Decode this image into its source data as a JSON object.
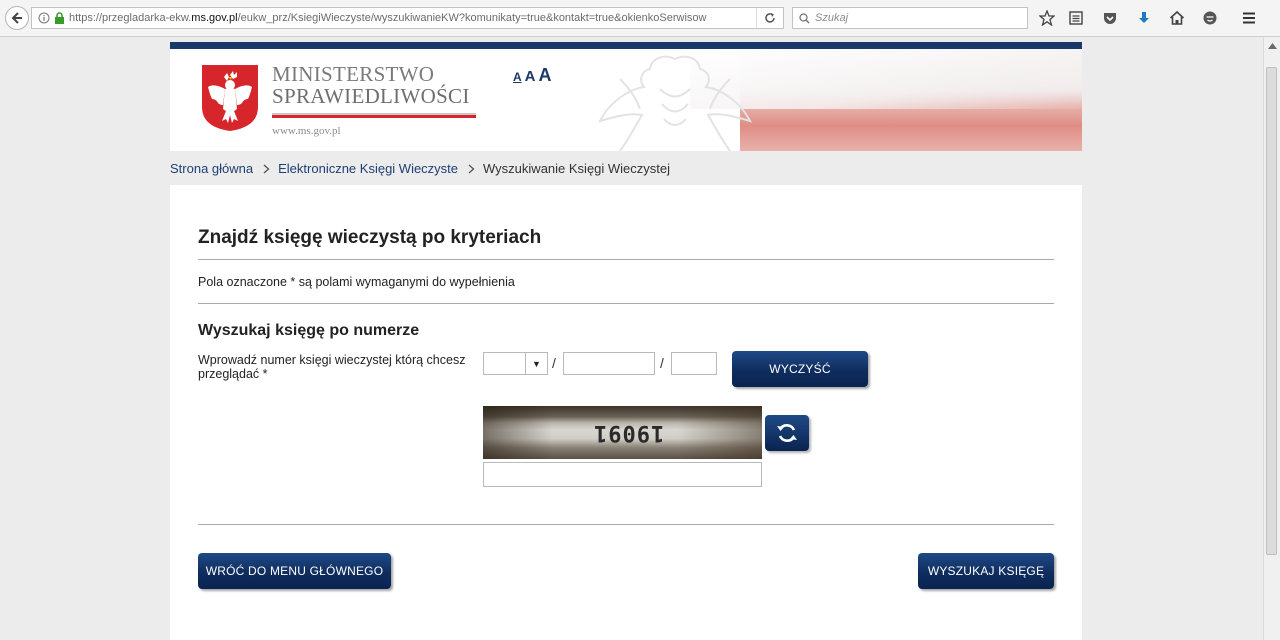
{
  "browser": {
    "url_prefix": "https://przegladarka-ekw.",
    "url_domain": "ms.gov.pl",
    "url_path": "/eukw_prz/KsiegiWieczyste/wyszukiwanieKW?komunikaty=true&kontakt=true&okienkoSerwisow",
    "search_placeholder": "Szukaj",
    "icons": [
      "back-icon",
      "info-icon",
      "lock-icon",
      "reload-icon",
      "search-icon",
      "star-icon",
      "reader-icon",
      "pocket-icon",
      "download-icon",
      "home-icon",
      "sync-icon",
      "menu-icon"
    ]
  },
  "header": {
    "ministry_line1": "MINISTERSTWO",
    "ministry_line2": "SPRAWIEDLIWOŚCI",
    "ministry_url": "www.ms.gov.pl",
    "font_size_small": "A",
    "font_size_medium": "A",
    "font_size_large": "A"
  },
  "breadcrumb": {
    "home": "Strona główna",
    "section": "Elektroniczne Księgi Wieczyste",
    "current": "Wyszukiwanie Księgi Wieczystej"
  },
  "form": {
    "title": "Znajdź księgę wieczystą po kryteriach",
    "required_note": "Pola oznaczone * są polami wymaganymi do wypełnienia",
    "subtitle": "Wyszukaj księgę po numerze",
    "number_label": "Wprowadź numer księgi wieczystej którą chcesz przeglądać *",
    "court_code_value": "",
    "kw_number_value": "",
    "check_digit_value": "",
    "separator": "/",
    "clear_button": "WYCZYŚĆ",
    "captcha_text": "19091",
    "captcha_input_value": "",
    "back_button": "WRÓĆ DO MENU GŁÓWNEGO",
    "search_button": "WYSZUKAJ KSIĘGĘ"
  },
  "colors": {
    "brand_navy": "#1b3968",
    "link": "#1e3f73",
    "eagle_red": "#d7262b"
  }
}
